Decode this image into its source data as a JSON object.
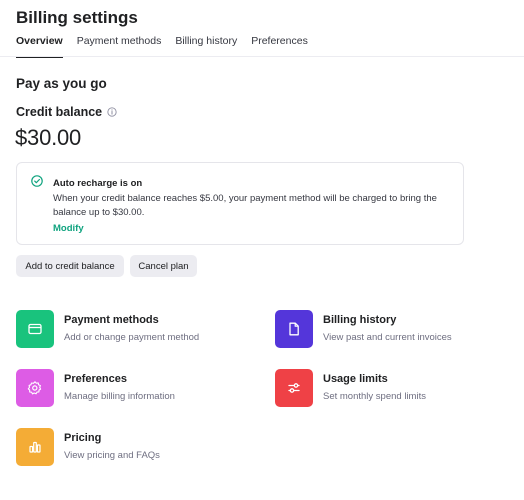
{
  "page": {
    "title": "Billing settings"
  },
  "tabs": [
    {
      "label": "Overview",
      "active": true
    },
    {
      "label": "Payment methods",
      "active": false
    },
    {
      "label": "Billing history",
      "active": false
    },
    {
      "label": "Preferences",
      "active": false
    }
  ],
  "plan": {
    "title": "Pay as you go"
  },
  "balance": {
    "label": "Credit balance",
    "value": "$30.00",
    "info_icon": "info-icon"
  },
  "recharge": {
    "icon": "check-circle-icon",
    "title": "Auto recharge is on",
    "description": "When your credit balance reaches $5.00, your payment method will be charged to bring the balance up to $30.00.",
    "link": "Modify"
  },
  "actions": {
    "add_label": "Add to credit balance",
    "cancel_label": "Cancel plan"
  },
  "cards": [
    {
      "title": "Payment methods",
      "description": "Add or change payment method",
      "icon": "credit-card-icon",
      "color": "#19c37d"
    },
    {
      "title": "Billing history",
      "description": "View past and current invoices",
      "icon": "document-icon",
      "color": "#5436da"
    },
    {
      "title": "Preferences",
      "description": "Manage billing information",
      "icon": "gear-icon",
      "color": "#dd5ce5"
    },
    {
      "title": "Usage limits",
      "description": "Set monthly spend limits",
      "icon": "sliders-icon",
      "color": "#ef4146"
    },
    {
      "title": "Pricing",
      "description": "View pricing and FAQs",
      "icon": "bar-chart-icon",
      "color": "#f4ac36"
    }
  ],
  "colors": {
    "accent_green": "#10a37f",
    "text": "#202123",
    "muted": "#6e6e80",
    "border": "#e5e5ea",
    "button_bg": "#ececf1"
  }
}
